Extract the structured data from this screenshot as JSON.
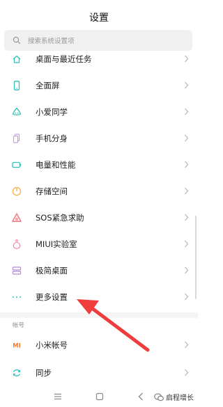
{
  "header": {
    "title": "设置"
  },
  "search": {
    "placeholder": "搜索系统设置项"
  },
  "items": [
    {
      "label": "桌面与最近任务",
      "icon": "home-icon"
    },
    {
      "label": "全面屏",
      "icon": "phone-icon"
    },
    {
      "label": "小爱同学",
      "icon": "xiaoai-icon"
    },
    {
      "label": "手机分身",
      "icon": "dual-phone-icon"
    },
    {
      "label": "电量和性能",
      "icon": "battery-icon"
    },
    {
      "label": "存储空间",
      "icon": "storage-icon"
    },
    {
      "label": "SOS紧急求助",
      "icon": "sos-icon"
    },
    {
      "label": "MIUI实验室",
      "icon": "lab-flask-icon"
    },
    {
      "label": "极简桌面",
      "icon": "simple-desktop-icon"
    },
    {
      "label": "更多设置",
      "icon": "more-dots-icon"
    }
  ],
  "account_section": {
    "label": "帐号"
  },
  "account_items": [
    {
      "label": "小米帐号",
      "icon": "mi-logo-icon"
    },
    {
      "label": "同步",
      "icon": "sync-icon"
    }
  ],
  "watermark": {
    "text": "启程增长"
  },
  "colors": {
    "accent_teal": "#2ec2b8",
    "arrow_red": "#ef3c3c",
    "mi_orange": "#ff7a1f"
  }
}
